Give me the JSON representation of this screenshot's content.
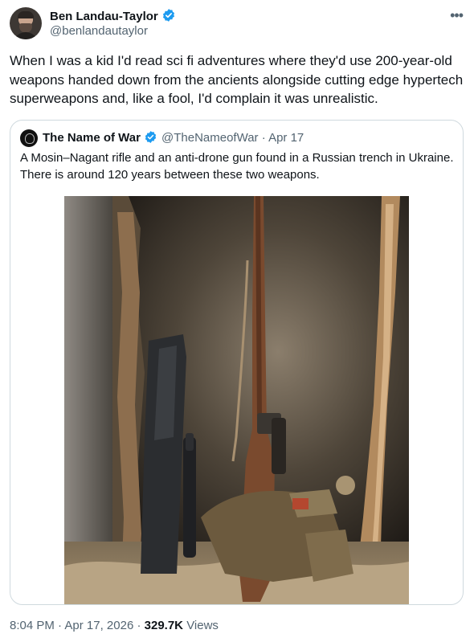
{
  "tweet": {
    "author_name": "Ben Landau-Taylor",
    "author_handle": "@benlandautaylor",
    "more_icon": "more-horizontal-icon",
    "text": "When I was a kid I'd read sci fi adventures where they'd use 200-year-old weapons handed down from the ancients alongside cutting edge hypertech superweapons and, like a fool, I'd complain it was unrealistic."
  },
  "quoted": {
    "author_name": "The Name of War",
    "author_handle": "@TheNameofWar",
    "date": "Apr 17",
    "text": "A Mosin–Nagant rifle and an anti-drone gun found in a Russian trench in Ukraine. There is around 120 years between these two weapons."
  },
  "footer": {
    "time": "8:04 PM",
    "date": "Apr 17, 2026",
    "views_count": "329.7K",
    "views_label": "Views"
  },
  "colors": {
    "verified": "#1d9bf0",
    "secondary_text": "#536471",
    "primary_text": "#0f1419",
    "border": "#cfd9de"
  }
}
